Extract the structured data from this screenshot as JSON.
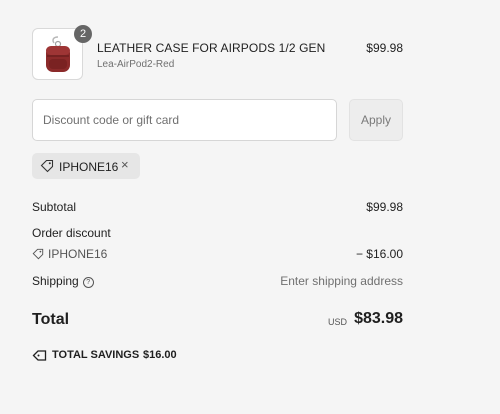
{
  "product": {
    "quantity": "2",
    "name": "LEATHER CASE FOR AIRPODS 1/2 GEN",
    "variant": "Lea-AirPod2-Red",
    "price": "$99.98",
    "image_icon": "leather-airpods-case"
  },
  "discount": {
    "placeholder": "Discount code or gift card",
    "value": "",
    "apply_label": "Apply",
    "applied_code": "IPHONE16",
    "remove_icon": "×"
  },
  "summary": {
    "subtotal_label": "Subtotal",
    "subtotal_value": "$99.98",
    "order_discount_label": "Order discount",
    "discount_code": "IPHONE16",
    "discount_value": "− $16.00",
    "shipping_label": "Shipping",
    "shipping_help": "?",
    "shipping_value": "Enter shipping address",
    "total_label": "Total",
    "total_currency": "USD",
    "total_value": "$83.98",
    "savings_label": "TOTAL SAVINGS",
    "savings_value": "$16.00"
  },
  "colors": {
    "background": "#f5f5f5",
    "case_leather": "#8b2a2a",
    "badge": "#666666"
  }
}
